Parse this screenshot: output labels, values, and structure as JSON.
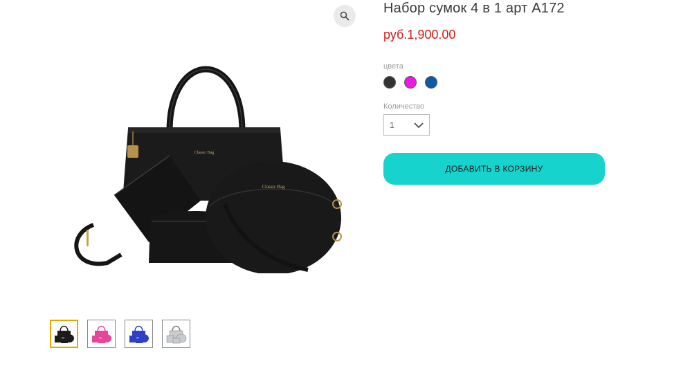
{
  "product": {
    "title": "Набор сумок 4 в 1 арт A172",
    "price": "руб.1,900.00"
  },
  "gallery": {
    "zoom_icon": "magnifier-icon",
    "thumbnails": [
      {
        "color": "#1a1a1a",
        "active": true
      },
      {
        "color": "#e8449a",
        "active": false
      },
      {
        "color": "#2f3fc8",
        "active": false
      },
      {
        "color": "#c9cccf",
        "active": false
      }
    ]
  },
  "options": {
    "color_label": "цвета",
    "colors": [
      "#333333",
      "#f016e8",
      "#0a5aa8"
    ],
    "quantity_label": "Количество",
    "quantity_value": "1"
  },
  "actions": {
    "add_to_cart_label": "ДОБАВИТЬ В КОРЗИНУ"
  },
  "theme": {
    "accent": "#16d3cd",
    "price_color": "#d21a1a",
    "active_thumb_border": "#e1a800"
  }
}
